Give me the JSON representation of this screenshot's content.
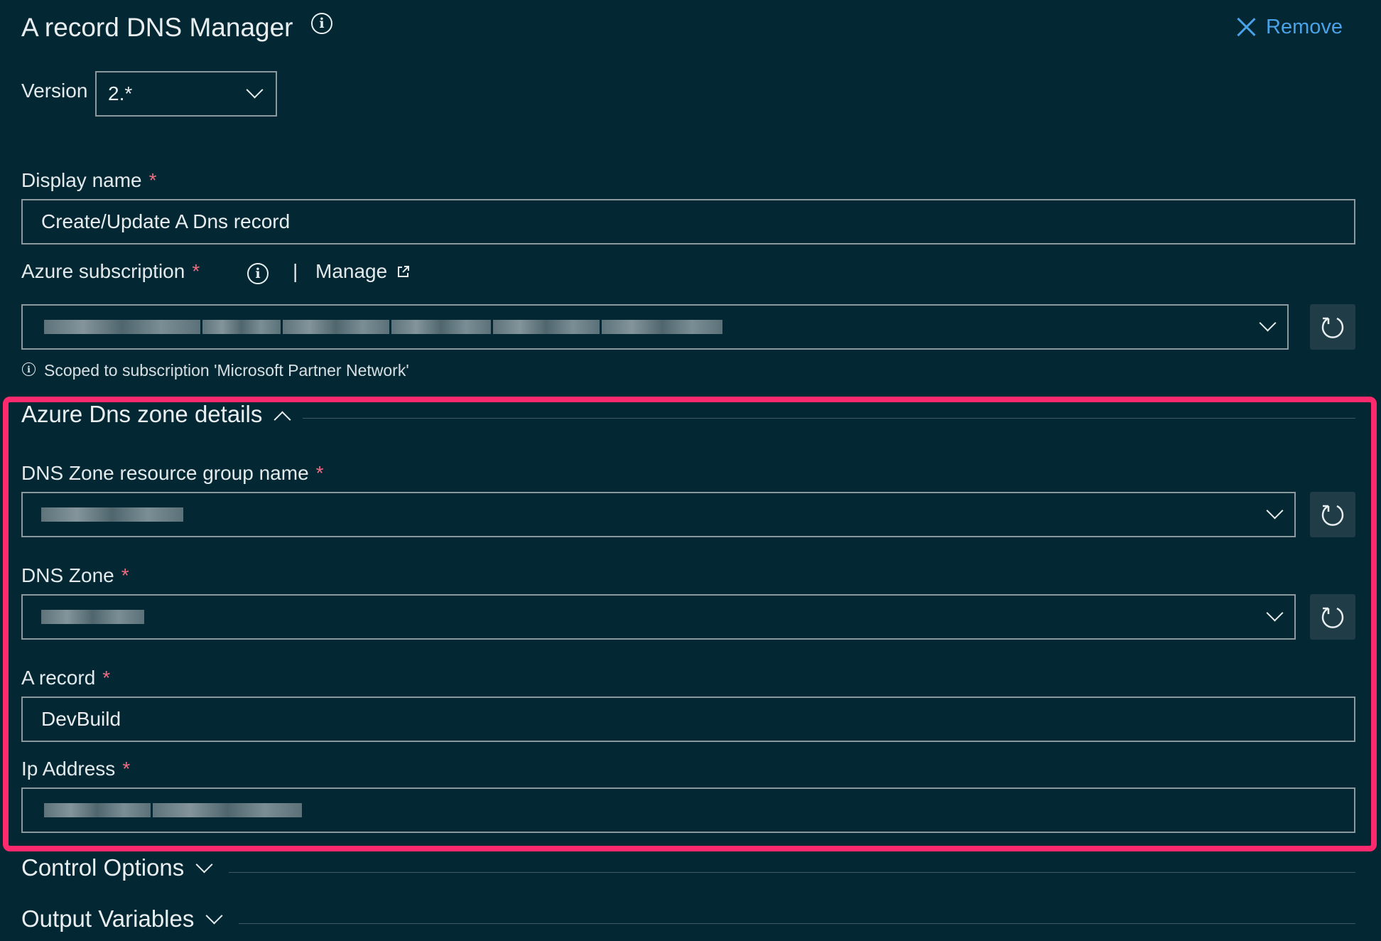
{
  "header": {
    "title": "A record DNS Manager",
    "remove_label": "Remove"
  },
  "version": {
    "label": "Version",
    "value": "2.*"
  },
  "display_name": {
    "label": "Display name",
    "required": "*",
    "value": "Create/Update A Dns record"
  },
  "subscription": {
    "label": "Azure subscription",
    "required": "*",
    "separator": "|",
    "manage_label": "Manage",
    "value_redacted": true,
    "scope_note": "Scoped to subscription 'Microsoft Partner Network'"
  },
  "dns_section": {
    "title": "Azure Dns zone details",
    "expanded": true,
    "resource_group": {
      "label": "DNS Zone resource group name",
      "required": "*",
      "value_redacted": true
    },
    "dns_zone": {
      "label": "DNS Zone",
      "required": "*",
      "value_redacted": true
    },
    "a_record": {
      "label": "A record",
      "required": "*",
      "value": "DevBuild"
    },
    "ip_address": {
      "label": "Ip Address",
      "required": "*",
      "value_redacted": true
    }
  },
  "collapsed_sections": {
    "control_options": "Control Options",
    "output_variables": "Output Variables"
  },
  "colors": {
    "background": "#032733",
    "accent_link": "#4aa2e8",
    "required_marker": "#ef6d83",
    "highlight_border": "#ff2a6d",
    "refresh_button": "#203c46"
  },
  "icons": [
    "info-icon",
    "close-icon",
    "chevron-down-icon",
    "chevron-up-icon",
    "external-link-icon",
    "refresh-icon"
  ]
}
